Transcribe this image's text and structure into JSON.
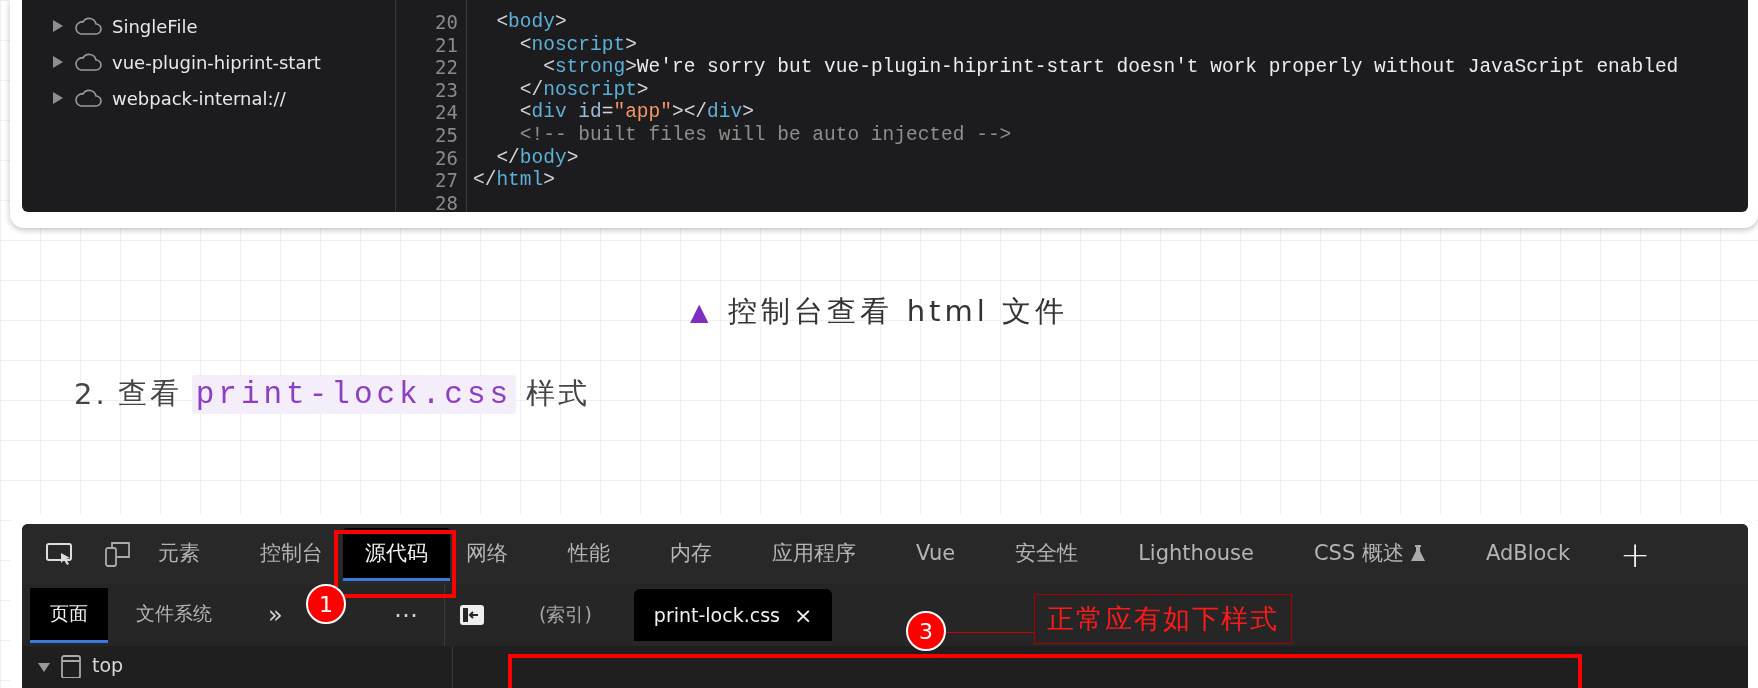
{
  "top_screenshot": {
    "file_tree": [
      {
        "label": "SingleFile",
        "expanded": false
      },
      {
        "label": "vue-plugin-hiprint-start",
        "expanded": false
      },
      {
        "label": "webpack-internal://",
        "expanded": false
      }
    ],
    "code_lines": [
      {
        "number": "20",
        "tokens": [
          {
            "kind": "punct",
            "text": "  <"
          },
          {
            "kind": "tag",
            "text": "body"
          },
          {
            "kind": "punct",
            "text": ">"
          }
        ]
      },
      {
        "number": "21",
        "tokens": [
          {
            "kind": "punct",
            "text": "    <"
          },
          {
            "kind": "tag",
            "text": "noscript"
          },
          {
            "kind": "punct",
            "text": ">"
          }
        ]
      },
      {
        "number": "22",
        "tokens": [
          {
            "kind": "punct",
            "text": "      <"
          },
          {
            "kind": "tag",
            "text": "strong"
          },
          {
            "kind": "punct",
            "text": ">"
          },
          {
            "kind": "text",
            "text": "We're sorry but vue-plugin-hiprint-start doesn't work properly without JavaScript enabled"
          }
        ]
      },
      {
        "number": "23",
        "tokens": [
          {
            "kind": "punct",
            "text": "    </"
          },
          {
            "kind": "tag",
            "text": "noscript"
          },
          {
            "kind": "punct",
            "text": ">"
          }
        ]
      },
      {
        "number": "24",
        "tokens": [
          {
            "kind": "punct",
            "text": "    <"
          },
          {
            "kind": "tag",
            "text": "div"
          },
          {
            "kind": "attr",
            "text": " id"
          },
          {
            "kind": "punct",
            "text": "="
          },
          {
            "kind": "string",
            "text": "\"app\""
          },
          {
            "kind": "punct",
            "text": "></"
          },
          {
            "kind": "tag",
            "text": "div"
          },
          {
            "kind": "punct",
            "text": ">"
          }
        ]
      },
      {
        "number": "25",
        "tokens": [
          {
            "kind": "comment",
            "text": "    <!-- built files will be auto injected -->"
          }
        ]
      },
      {
        "number": "26",
        "tokens": [
          {
            "kind": "punct",
            "text": "  </"
          },
          {
            "kind": "tag",
            "text": "body"
          },
          {
            "kind": "punct",
            "text": ">"
          }
        ]
      },
      {
        "number": "27",
        "tokens": [
          {
            "kind": "punct",
            "text": "</"
          },
          {
            "kind": "tag",
            "text": "html"
          },
          {
            "kind": "punct",
            "text": ">"
          }
        ]
      },
      {
        "number": "28"
      }
    ]
  },
  "caption": {
    "marker": "▲",
    "text": "控制台查看 html 文件"
  },
  "step": {
    "number": "2.",
    "before": "查看",
    "code": "print-lock.css",
    "after": "样式"
  },
  "devtools": {
    "main_tabs": [
      {
        "label": "元素",
        "selected": false
      },
      {
        "label": "控制台",
        "selected": false
      },
      {
        "label": "源代码",
        "selected": true
      },
      {
        "label": "网络",
        "selected": false
      },
      {
        "label": "性能",
        "selected": false
      },
      {
        "label": "内存",
        "selected": false
      },
      {
        "label": "应用程序",
        "selected": false
      },
      {
        "label": "Vue",
        "selected": false
      },
      {
        "label": "安全性",
        "selected": false
      },
      {
        "label": "Lighthouse",
        "selected": false
      },
      {
        "label": "CSS 概述",
        "selected": false,
        "experimental": true
      },
      {
        "label": "AdBlock",
        "selected": false
      }
    ],
    "add_tab": "+",
    "nav_tabs": [
      {
        "label": "页面",
        "selected": true
      },
      {
        "label": "文件系统",
        "selected": false
      }
    ],
    "more_tabs": "»",
    "menu": "⋯",
    "editor_tabs": [
      {
        "label": "(索引)",
        "selected": false,
        "closable": false
      },
      {
        "label": "print-lock.css",
        "selected": true,
        "closable": true
      }
    ],
    "close_glyph": "×",
    "tree": [
      {
        "label": "top",
        "expanded": true
      }
    ],
    "annotations": {
      "badge_sources": "1",
      "badge_styles": "3",
      "note": "正常应有如下样式"
    }
  }
}
